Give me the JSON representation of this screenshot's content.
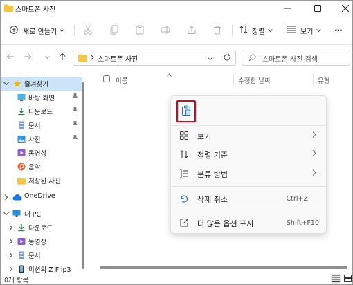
{
  "window": {
    "title": "스마트폰 사진",
    "controls": [
      "minimize",
      "maximize",
      "close"
    ]
  },
  "commandbar": {
    "new_label": "새로 만들기",
    "sort_label": "정렬",
    "view_label": "보기",
    "more_label": "···"
  },
  "address": {
    "path": "스마트폰 사진",
    "search_placeholder": "스마트폰 사진 검색"
  },
  "columns": {
    "name": "이름",
    "modified": "수정한 날짜",
    "type": "유형"
  },
  "navpane": {
    "quick_access": "즐겨찾기",
    "desktop": "바탕 화면",
    "downloads": "다운로드",
    "documents": "문서",
    "pictures": "사진",
    "videos": "동영상",
    "music": "음악",
    "saved_pictures": "저장된 사진",
    "onedrive": "OneDrive",
    "this_pc": "내 PC",
    "pc_downloads": "다운로드",
    "pc_videos": "동영상",
    "pc_documents": "문서",
    "phone": "미션의 Z Flip3"
  },
  "status": {
    "item_count": "0개 항목"
  },
  "context_menu": {
    "view": "보기",
    "sort_by": "정렬 기준",
    "group_by": "분류 방법",
    "undo_delete": "삭제 취소",
    "undo_shortcut": "Ctrl+Z",
    "more_options": "더 많은 옵션 표시",
    "more_shortcut": "Shift+F10"
  },
  "colors": {
    "accent": "#0067c0",
    "folder": "#f5c542",
    "selection": "#cce4f7",
    "highlight_box": "#e0001b"
  }
}
